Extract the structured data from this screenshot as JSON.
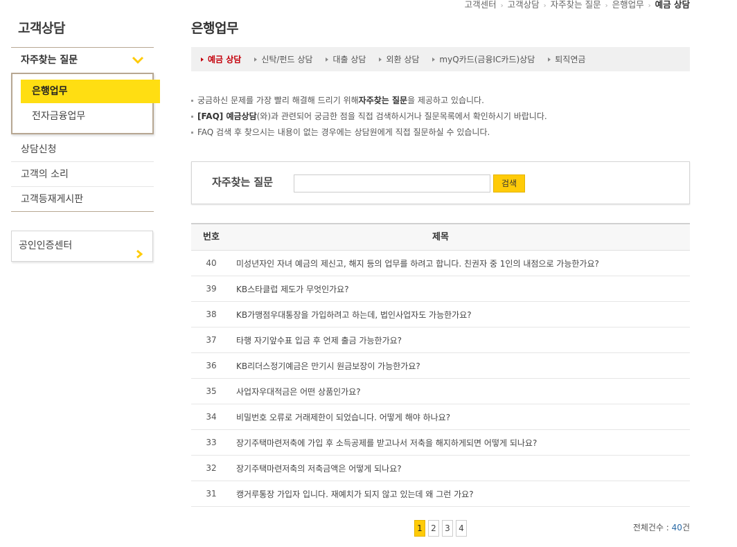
{
  "sidebar": {
    "title": "고객상담",
    "faq_label": "자주찾는 질문",
    "sub_items": [
      "은행업무",
      "전자금융업무"
    ],
    "links": [
      "상담신청",
      "고객의 소리",
      "고객등재게시판"
    ],
    "cert_label": "공인인증센터"
  },
  "breadcrumb": [
    "고객센터",
    "고객상담",
    "자주찾는 질문",
    "은행업무",
    "예금 상담"
  ],
  "page_title": "은행업무",
  "tabs": [
    "예금 상담",
    "신탁/펀드 상담",
    "대출 상담",
    "외환 상담",
    "myQ카드(금융IC카드)상담",
    "퇴직연금"
  ],
  "notices": {
    "n1_pre": "궁금하신 문제를 가장 빨리 해결해 드리기 위해 ",
    "n1_bold": "자주찾는 질문",
    "n1_post": "을 제공하고 있습니다.",
    "n2_bold": "[FAQ] 예금상담",
    "n2_post": "(와)과 관련되어 궁금한 점을 직접 검색하시거나 질문목록에서 확인하시기 바랍니다.",
    "n3": "FAQ 검색 후 찾으시는 내용이 없는 경우에는 상담원에게 직접 질문하실 수 있습니다."
  },
  "search": {
    "label": "자주찾는 질문",
    "value": "",
    "button": "검색"
  },
  "table": {
    "headers": [
      "번호",
      "제목"
    ],
    "rows": [
      {
        "num": "40",
        "title": "미성년자인 자녀 예금의 제신고, 해지 등의 업무를 하려고 합니다. 친권자 중 1인의 내점으로 가능한가요?"
      },
      {
        "num": "39",
        "title": "KB스타클럽 제도가 무엇인가요?"
      },
      {
        "num": "38",
        "title": "KB가맹점우대통장을 가입하려고 하는데, 법인사업자도 가능한가요?"
      },
      {
        "num": "37",
        "title": "타행 자기앞수표 입금 후 언제 출금 가능한가요?"
      },
      {
        "num": "36",
        "title": "KB리더스정기예금은 만기시 원금보장이 가능한가요?"
      },
      {
        "num": "35",
        "title": "사업자우대적금은 어떤 상품인가요?"
      },
      {
        "num": "34",
        "title": "비밀번호 오류로 거래제한이 되었습니다. 어떻게 해야 하나요?"
      },
      {
        "num": "33",
        "title": "장기주택마련저축에 가입 후 소득공제를 받고나서 저축을 해지하게되면 어떻게 되나요?"
      },
      {
        "num": "32",
        "title": "장기주택마련저축의 저축금액은 어떻게 되나요?"
      },
      {
        "num": "31",
        "title": "캥거루통장 가입자 입니다. 재예치가 되지 않고 있는데 왜 그런 가요?"
      }
    ]
  },
  "pagination": {
    "pages": [
      "1",
      "2",
      "3",
      "4"
    ],
    "current": "1"
  },
  "total": {
    "label": "전체건수 : ",
    "count": "40",
    "unit": "건"
  },
  "colors": {
    "accent_yellow": "#ffde12",
    "button_yellow": "#ffcb08",
    "active_tab_red": "#c4000b",
    "border_brown": "#b7a792"
  }
}
